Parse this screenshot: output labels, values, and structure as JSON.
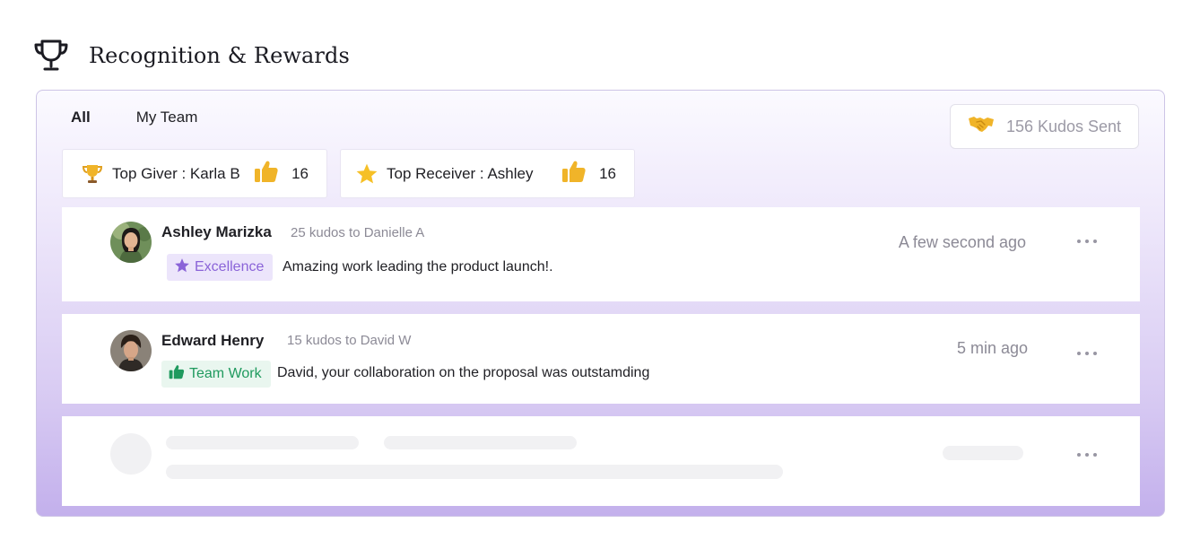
{
  "header": {
    "title": "Recognition & Rewards",
    "icon": "trophy-icon"
  },
  "tabs": [
    {
      "label": "All",
      "active": true
    },
    {
      "label": "My Team",
      "active": false
    }
  ],
  "kudos_sent": {
    "label": "156 Kudos Sent",
    "icon": "handshake-icon"
  },
  "stats": {
    "top_giver": {
      "label": "Top Giver : Karla B",
      "count": "16",
      "icon": "trophy-icon"
    },
    "top_receiver": {
      "label": "Top Receiver : Ashley",
      "count": "16",
      "icon": "star-icon"
    }
  },
  "feed": [
    {
      "name": "Ashley Marizka",
      "kudos_text": "25 kudos to Danielle A",
      "tag": "Excellence",
      "message": "Amazing work leading the product launch!.",
      "time": "A few second ago"
    },
    {
      "name": "Edward Henry",
      "kudos_text": "15 kudos to David W",
      "tag": "Team Work",
      "message": "David, your collaboration on the proposal was outstamding",
      "time": "5 min ago"
    }
  ],
  "colors": {
    "accent_purple": "#8a63d8",
    "team_green": "#1f9a5e",
    "gold": "#f0b429",
    "panel_gradient_end": "#c3b0ec"
  }
}
